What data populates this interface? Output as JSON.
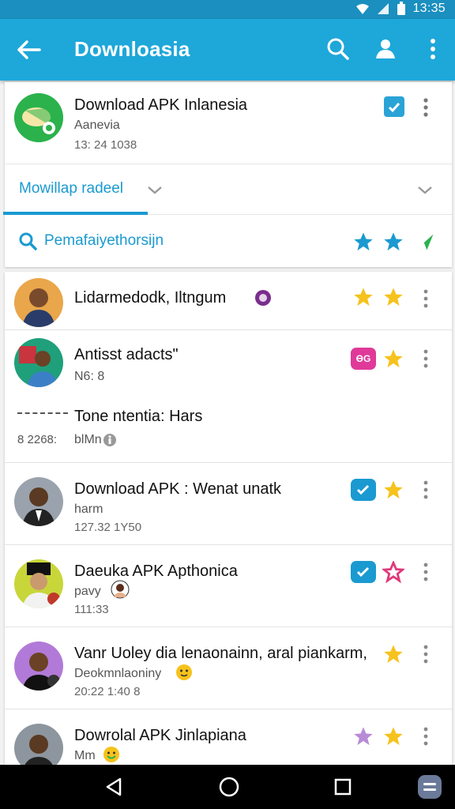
{
  "status": {
    "time": "13:35"
  },
  "appbar": {
    "title": "Downloasia"
  },
  "hero": {
    "name": "Download APK Inlanesia",
    "sub": "Aanevia",
    "meta": "13: 24 1038"
  },
  "tabs": {
    "active": "Mowillap radeel"
  },
  "search": {
    "text": "Pemafaiyethorsijn"
  },
  "colors": {
    "accent": "#1ea7d9",
    "star_gold": "#f6c21c",
    "star_blue": "#1a9ad1",
    "green": "#2bb24c"
  },
  "items": [
    {
      "title": "Lidarmedodk, Iltngum",
      "stars": [
        "gold",
        "gold"
      ]
    },
    {
      "title": "Antisst adacts\"",
      "l2": "N6: 8",
      "badge": "ӨG",
      "stars": [
        "gold"
      ]
    },
    {
      "title": "Tone ntentia: Hars",
      "left": "8 2268:",
      "l2": "blMn"
    },
    {
      "title": "Download APK : Wenat unatk",
      "l2": "harm",
      "l3": "127.32  1Y50",
      "stars": [
        "gold"
      ]
    },
    {
      "title": "Daeuka APK Apthonica",
      "l2": "pavy",
      "l3": "111:33",
      "stars": [
        "pink-outline"
      ]
    },
    {
      "title": "Vanr Uoley dia lenaonainn, aral piankarm,",
      "l2": "Deokmnlaoniny",
      "l3": "20:22  1:40 8",
      "stars": [
        "gold"
      ]
    },
    {
      "title": "Dowrolal APK Jinlapiana",
      "l2": "Mm",
      "stars": [
        "purple",
        "gold"
      ]
    }
  ]
}
